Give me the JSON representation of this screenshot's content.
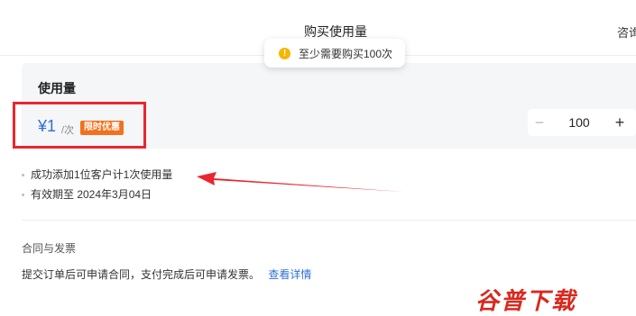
{
  "header": {
    "title": "购买使用量",
    "right_label": "咨询"
  },
  "toast": {
    "icon": "warning-icon",
    "text": "至少需要购买100次"
  },
  "card": {
    "title": "使用量",
    "price": "¥1",
    "unit": "/次",
    "badge": "限时优惠",
    "quantity": "100",
    "minus": "−",
    "plus": "+"
  },
  "bullets": [
    "成功添加1位客户计1次使用量",
    "有效期至 2024年3月04日"
  ],
  "contract": {
    "title": "合同与发票",
    "note": "提交订单后可申请合同，支付完成后可申请发票。",
    "link": "查看详情"
  },
  "watermark": "谷普下载",
  "colors": {
    "accent": "#2f6fdb",
    "badge": "#f2711c",
    "highlight": "#e8262f",
    "warning": "#f7b500"
  }
}
